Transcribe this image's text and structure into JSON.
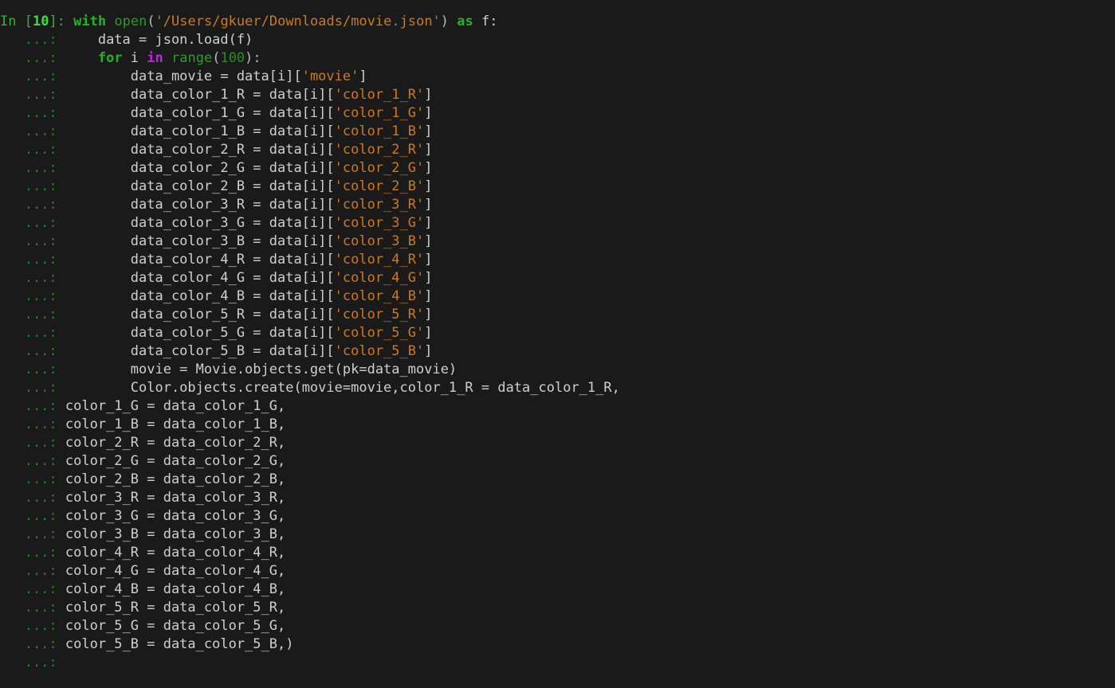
{
  "terminal": {
    "app": "ipython-console",
    "background_color": "#1a1a1a",
    "prompt_in_label": "In [",
    "prompt_in_number": "10",
    "prompt_in_close": "]:",
    "prompt_continuation": "   ...:",
    "colors": {
      "background": "#1a1a1a",
      "prompt_green": "#2fb62f",
      "keyword_green": "#24b324",
      "keyword_purple": "#b829d6",
      "string_orange": "#cc7a1f",
      "plain_text": "#cfcfcf",
      "number_green": "#2a8c2a"
    },
    "lines": [
      {
        "prompt": "in",
        "code": "with open('/Users/gkuer/Downloads/movie.json') as f:",
        "tokens": [
          {
            "t": "with",
            "c": "kw"
          },
          {
            "t": " ",
            "c": "plain"
          },
          {
            "t": "open",
            "c": "builtin"
          },
          {
            "t": "(",
            "c": "punct"
          },
          {
            "t": "'/Users/gkuer/Downloads/movie.json'",
            "c": "str"
          },
          {
            "t": ")",
            "c": "punct"
          },
          {
            "t": " ",
            "c": "plain"
          },
          {
            "t": "as",
            "c": "kw"
          },
          {
            "t": " f:",
            "c": "plain"
          }
        ]
      },
      {
        "prompt": "cont",
        "code": "    data = json.load(f)",
        "tokens": [
          {
            "t": "    data = json.load(f)",
            "c": "plain"
          }
        ]
      },
      {
        "prompt": "cont",
        "code": "    for i in range(100):",
        "tokens": [
          {
            "t": "    ",
            "c": "plain"
          },
          {
            "t": "for",
            "c": "kw"
          },
          {
            "t": " i ",
            "c": "plain"
          },
          {
            "t": "in",
            "c": "kw-op"
          },
          {
            "t": " ",
            "c": "plain"
          },
          {
            "t": "range",
            "c": "builtin"
          },
          {
            "t": "(",
            "c": "punct"
          },
          {
            "t": "100",
            "c": "num"
          },
          {
            "t": "):",
            "c": "punct"
          }
        ]
      },
      {
        "prompt": "cont",
        "code": "        data_movie = data[i]['movie']",
        "tokens": [
          {
            "t": "        data_movie = data[i][",
            "c": "plain"
          },
          {
            "t": "'movie'",
            "c": "str"
          },
          {
            "t": "]",
            "c": "plain"
          }
        ]
      },
      {
        "prompt": "cont",
        "code": "        data_color_1_R = data[i]['color_1_R']",
        "tokens": [
          {
            "t": "        data_color_1_R = data[i][",
            "c": "plain"
          },
          {
            "t": "'color_1_R'",
            "c": "str"
          },
          {
            "t": "]",
            "c": "plain"
          }
        ]
      },
      {
        "prompt": "cont",
        "code": "        data_color_1_G = data[i]['color_1_G']",
        "tokens": [
          {
            "t": "        data_color_1_G = data[i][",
            "c": "plain"
          },
          {
            "t": "'color_1_G'",
            "c": "str"
          },
          {
            "t": "]",
            "c": "plain"
          }
        ]
      },
      {
        "prompt": "cont",
        "code": "        data_color_1_B = data[i]['color_1_B']",
        "tokens": [
          {
            "t": "        data_color_1_B = data[i][",
            "c": "plain"
          },
          {
            "t": "'color_1_B'",
            "c": "str"
          },
          {
            "t": "]",
            "c": "plain"
          }
        ]
      },
      {
        "prompt": "cont",
        "code": "        data_color_2_R = data[i]['color_2_R']",
        "tokens": [
          {
            "t": "        data_color_2_R = data[i][",
            "c": "plain"
          },
          {
            "t": "'color_2_R'",
            "c": "str"
          },
          {
            "t": "]",
            "c": "plain"
          }
        ]
      },
      {
        "prompt": "cont",
        "code": "        data_color_2_G = data[i]['color_2_G']",
        "tokens": [
          {
            "t": "        data_color_2_G = data[i][",
            "c": "plain"
          },
          {
            "t": "'color_2_G'",
            "c": "str"
          },
          {
            "t": "]",
            "c": "plain"
          }
        ]
      },
      {
        "prompt": "cont",
        "code": "        data_color_2_B = data[i]['color_2_B']",
        "tokens": [
          {
            "t": "        data_color_2_B = data[i][",
            "c": "plain"
          },
          {
            "t": "'color_2_B'",
            "c": "str"
          },
          {
            "t": "]",
            "c": "plain"
          }
        ]
      },
      {
        "prompt": "cont",
        "code": "        data_color_3_R = data[i]['color_3_R']",
        "tokens": [
          {
            "t": "        data_color_3_R = data[i][",
            "c": "plain"
          },
          {
            "t": "'color_3_R'",
            "c": "str"
          },
          {
            "t": "]",
            "c": "plain"
          }
        ]
      },
      {
        "prompt": "cont",
        "code": "        data_color_3_G = data[i]['color_3_G']",
        "tokens": [
          {
            "t": "        data_color_3_G = data[i][",
            "c": "plain"
          },
          {
            "t": "'color_3_G'",
            "c": "str"
          },
          {
            "t": "]",
            "c": "plain"
          }
        ]
      },
      {
        "prompt": "cont",
        "code": "        data_color_3_B = data[i]['color_3_B']",
        "tokens": [
          {
            "t": "        data_color_3_B = data[i][",
            "c": "plain"
          },
          {
            "t": "'color_3_B'",
            "c": "str"
          },
          {
            "t": "]",
            "c": "plain"
          }
        ]
      },
      {
        "prompt": "cont",
        "code": "        data_color_4_R = data[i]['color_4_R']",
        "tokens": [
          {
            "t": "        data_color_4_R = data[i][",
            "c": "plain"
          },
          {
            "t": "'color_4_R'",
            "c": "str"
          },
          {
            "t": "]",
            "c": "plain"
          }
        ]
      },
      {
        "prompt": "cont",
        "code": "        data_color_4_G = data[i]['color_4_G']",
        "tokens": [
          {
            "t": "        data_color_4_G = data[i][",
            "c": "plain"
          },
          {
            "t": "'color_4_G'",
            "c": "str"
          },
          {
            "t": "]",
            "c": "plain"
          }
        ]
      },
      {
        "prompt": "cont",
        "code": "        data_color_4_B = data[i]['color_4_B']",
        "tokens": [
          {
            "t": "        data_color_4_B = data[i][",
            "c": "plain"
          },
          {
            "t": "'color_4_B'",
            "c": "str"
          },
          {
            "t": "]",
            "c": "plain"
          }
        ]
      },
      {
        "prompt": "cont",
        "code": "        data_color_5_R = data[i]['color_5_R']",
        "tokens": [
          {
            "t": "        data_color_5_R = data[i][",
            "c": "plain"
          },
          {
            "t": "'color_5_R'",
            "c": "str"
          },
          {
            "t": "]",
            "c": "plain"
          }
        ]
      },
      {
        "prompt": "cont",
        "code": "        data_color_5_G = data[i]['color_5_G']",
        "tokens": [
          {
            "t": "        data_color_5_G = data[i][",
            "c": "plain"
          },
          {
            "t": "'color_5_G'",
            "c": "str"
          },
          {
            "t": "]",
            "c": "plain"
          }
        ]
      },
      {
        "prompt": "cont",
        "code": "        data_color_5_B = data[i]['color_5_B']",
        "tokens": [
          {
            "t": "        data_color_5_B = data[i][",
            "c": "plain"
          },
          {
            "t": "'color_5_B'",
            "c": "str"
          },
          {
            "t": "]",
            "c": "plain"
          }
        ]
      },
      {
        "prompt": "cont",
        "code": "        movie = Movie.objects.get(pk=data_movie)",
        "tokens": [
          {
            "t": "        movie = Movie.objects.get(pk=data_movie)",
            "c": "plain"
          }
        ]
      },
      {
        "prompt": "cont",
        "code": "        Color.objects.create(movie=movie,color_1_R = data_color_1_R,",
        "tokens": [
          {
            "t": "        Color.objects.create(movie=movie,color_1_R = data_color_1_R,",
            "c": "plain"
          }
        ]
      },
      {
        "prompt": "cont-wrap",
        "code": "color_1_G = data_color_1_G,",
        "tokens": [
          {
            "t": "color_1_G = data_color_1_G,",
            "c": "plain"
          }
        ]
      },
      {
        "prompt": "cont-wrap",
        "code": "color_1_B = data_color_1_B,",
        "tokens": [
          {
            "t": "color_1_B = data_color_1_B,",
            "c": "plain"
          }
        ]
      },
      {
        "prompt": "cont-wrap",
        "code": "color_2_R = data_color_2_R,",
        "tokens": [
          {
            "t": "color_2_R = data_color_2_R,",
            "c": "plain"
          }
        ]
      },
      {
        "prompt": "cont-wrap",
        "code": "color_2_G = data_color_2_G,",
        "tokens": [
          {
            "t": "color_2_G = data_color_2_G,",
            "c": "plain"
          }
        ]
      },
      {
        "prompt": "cont-wrap",
        "code": "color_2_B = data_color_2_B,",
        "tokens": [
          {
            "t": "color_2_B = data_color_2_B,",
            "c": "plain"
          }
        ]
      },
      {
        "prompt": "cont-wrap",
        "code": "color_3_R = data_color_3_R,",
        "tokens": [
          {
            "t": "color_3_R = data_color_3_R,",
            "c": "plain"
          }
        ]
      },
      {
        "prompt": "cont-wrap",
        "code": "color_3_G = data_color_3_G,",
        "tokens": [
          {
            "t": "color_3_G = data_color_3_G,",
            "c": "plain"
          }
        ]
      },
      {
        "prompt": "cont-wrap",
        "code": "color_3_B = data_color_3_B,",
        "tokens": [
          {
            "t": "color_3_B = data_color_3_B,",
            "c": "plain"
          }
        ]
      },
      {
        "prompt": "cont-wrap",
        "code": "color_4_R = data_color_4_R,",
        "tokens": [
          {
            "t": "color_4_R = data_color_4_R,",
            "c": "plain"
          }
        ]
      },
      {
        "prompt": "cont-wrap",
        "code": "color_4_G = data_color_4_G,",
        "tokens": [
          {
            "t": "color_4_G = data_color_4_G,",
            "c": "plain"
          }
        ]
      },
      {
        "prompt": "cont-wrap",
        "code": "color_4_B = data_color_4_B,",
        "tokens": [
          {
            "t": "color_4_B = data_color_4_B,",
            "c": "plain"
          }
        ]
      },
      {
        "prompt": "cont-wrap",
        "code": "color_5_R = data_color_5_R,",
        "tokens": [
          {
            "t": "color_5_R = data_color_5_R,",
            "c": "plain"
          }
        ]
      },
      {
        "prompt": "cont-wrap",
        "code": "color_5_G = data_color_5_G,",
        "tokens": [
          {
            "t": "color_5_G = data_color_5_G,",
            "c": "plain"
          }
        ]
      },
      {
        "prompt": "cont-wrap",
        "code": "color_5_B = data_color_5_B,)",
        "tokens": [
          {
            "t": "color_5_B = data_color_5_B,)",
            "c": "plain"
          }
        ]
      },
      {
        "prompt": "cont",
        "code": "",
        "tokens": []
      }
    ]
  }
}
